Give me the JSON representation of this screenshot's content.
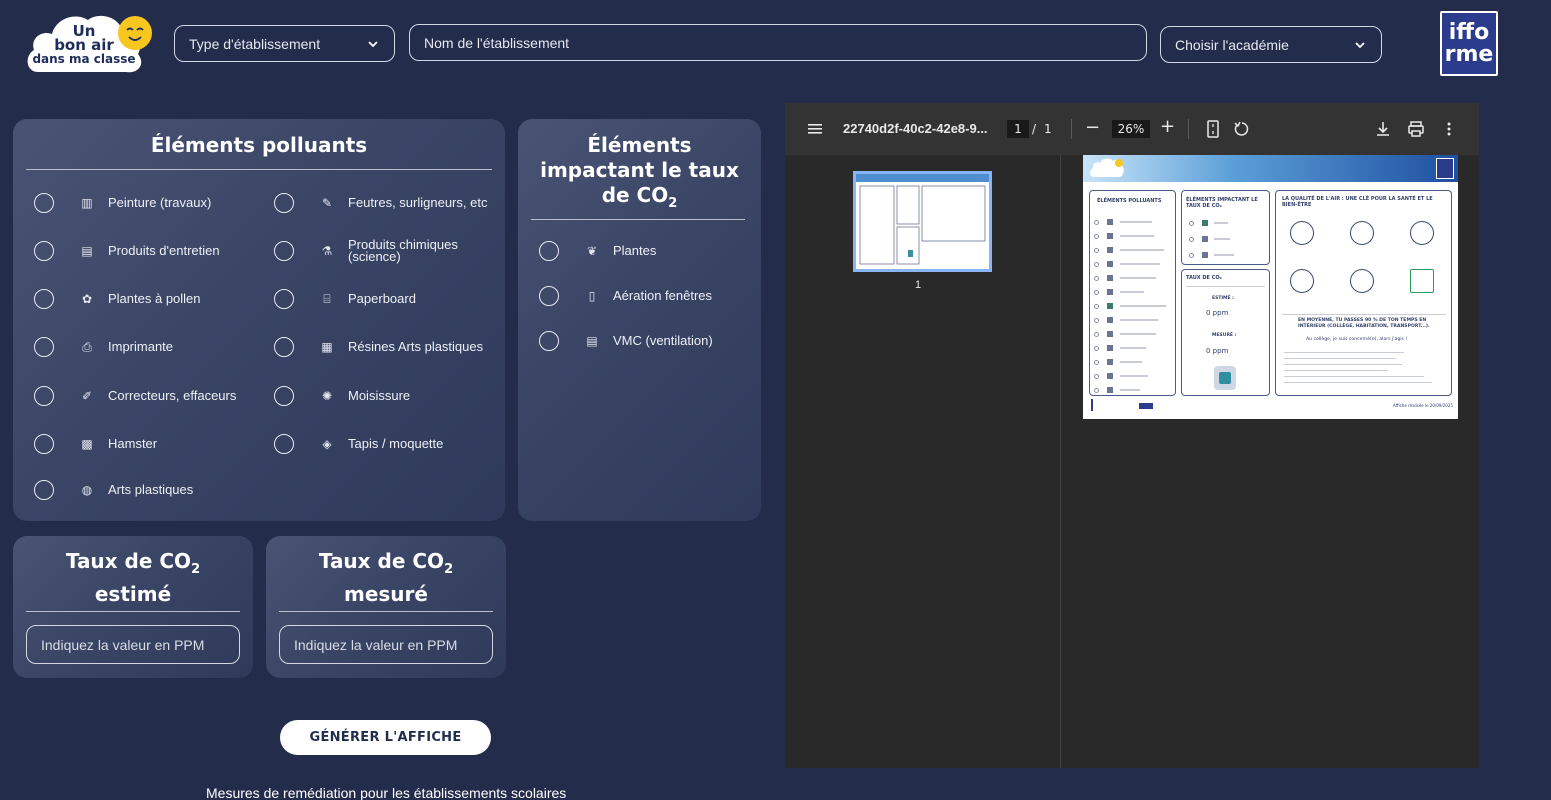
{
  "header": {
    "logo": {
      "line1": "Un",
      "line2": "bon air",
      "line3": "dans ma classe"
    },
    "type_select": {
      "placeholder": "Type d'établissement"
    },
    "name_input": {
      "placeholder": "Nom de l'établissement"
    },
    "academy_select": {
      "placeholder": "Choisir l'académie"
    },
    "partner_logo": {
      "line1": "iffo",
      "line2": "rme"
    }
  },
  "pollutants": {
    "title": "Éléments polluants",
    "items": [
      {
        "label": "Peinture (travaux)",
        "icon": "paint-bucket-icon"
      },
      {
        "label": "Feutres, surligneurs, etc",
        "icon": "marker-icon"
      },
      {
        "label": "Produits d'entretien",
        "icon": "cleaning-products-icon"
      },
      {
        "label": "Produits chimiques (science)",
        "icon": "flask-icon"
      },
      {
        "label": "Plantes à pollen",
        "icon": "flower-icon"
      },
      {
        "label": "Paperboard",
        "icon": "easel-icon"
      },
      {
        "label": "Imprimante",
        "icon": "printer-icon"
      },
      {
        "label": "Résines Arts plastiques",
        "icon": "resin-icon"
      },
      {
        "label": "Correcteurs, effaceurs",
        "icon": "pen-icon"
      },
      {
        "label": "Moisissure",
        "icon": "mold-icon"
      },
      {
        "label": "Hamster",
        "icon": "cage-icon"
      },
      {
        "label": "Tapis / moquette",
        "icon": "carpet-icon"
      },
      {
        "label": "Arts plastiques",
        "icon": "palette-icon"
      }
    ]
  },
  "co2_impact": {
    "title_main": "Éléments impactant le taux de CO",
    "title_sub": "2",
    "items": [
      {
        "label": "Plantes",
        "icon": "leaf-icon"
      },
      {
        "label": "Aération fenêtres",
        "icon": "window-icon"
      },
      {
        "label": "VMC (ventilation)",
        "icon": "vent-icon"
      }
    ]
  },
  "co2_estimated": {
    "title_a": "Taux de CO",
    "title_sub": "2",
    "title_b": "estimé",
    "placeholder": "Indiquez la valeur en PPM"
  },
  "co2_measured": {
    "title_a": "Taux de CO",
    "title_sub": "2",
    "title_b": "mesuré",
    "placeholder": "Indiquez la valeur en PPM"
  },
  "generate_button": "GÉNÉRER L'AFFICHE",
  "footer_link": "Mesures de remédiation pour les établissements scolaires",
  "pdf_viewer": {
    "filename": "22740d2f-40c2-42e8-9...",
    "current_page": "1",
    "page_sep": "/",
    "total_pages": "1",
    "zoom": "26%",
    "thumb_label": "1",
    "doc": {
      "col1_title": "ÉLÉMENTS POLLUANTS",
      "col2_title": "ÉLÉMENTS IMPACTANT LE TAUX DE CO₂",
      "col2b_title": "TAUX DE CO₂",
      "estimated_label": "ESTIMÉ :",
      "estimated_value": "0 ppm",
      "measured_label": "MESURÉ :",
      "measured_value": "0 ppm",
      "col3_title": "LA QUALITÉ DE L'AIR : UNE CLÉ POUR LA SANTÉ ET LE BIEN-ÊTRE",
      "col3_para": "EN MOYENNE, TU PASSES 90 % DE TON TEMPS EN INTÉRIEUR (COLLÈGE, HABITATION, TRANSPORT...).",
      "col3_sub": "Au collège, je suis concerné(e), alors j'agis !",
      "footer_note": "Affiche réalisée le 20/09/2025"
    }
  },
  "colors": {
    "background": "#232d4b",
    "card": "#3a4566",
    "button_bg": "#ffffff",
    "button_text": "#1f2d4f",
    "pdf_toolbar": "#333333",
    "pdf_bg": "#292929",
    "thumb_border": "#8ab4f8",
    "sun": "#f7c71f"
  }
}
